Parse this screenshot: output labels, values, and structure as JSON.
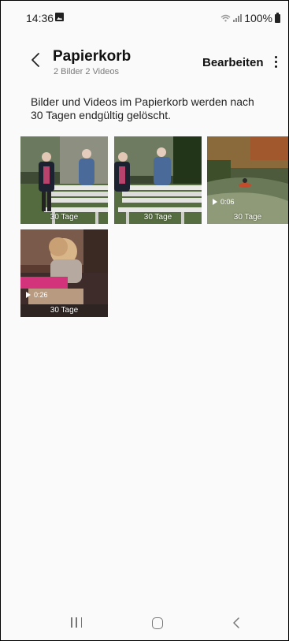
{
  "status": {
    "time": "14:36",
    "battery": "100%"
  },
  "header": {
    "title": "Papierkorb",
    "subtitle": "2 Bilder 2 Videos",
    "edit_label": "Bearbeiten"
  },
  "info_text": "Bilder und Videos im Papierkorb werden nach 30 Tagen endgültig gelöscht.",
  "items": [
    {
      "type": "image",
      "days": "30 Tage"
    },
    {
      "type": "image",
      "days": "30 Tage"
    },
    {
      "type": "video",
      "days": "30 Tage",
      "duration": "0:06"
    },
    {
      "type": "video",
      "days": "30 Tage",
      "duration": "0:26"
    }
  ],
  "nav_icons": [
    "recent-apps-icon",
    "home-icon",
    "back-icon"
  ]
}
